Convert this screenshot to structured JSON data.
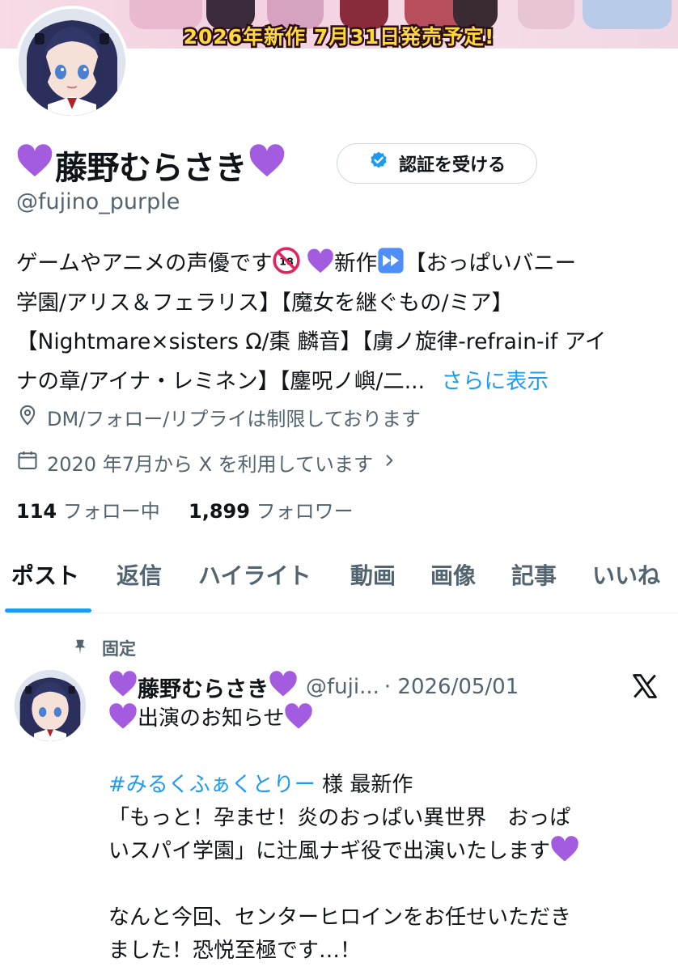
{
  "banner": {
    "text": "2026年新作 7月31日発売予定!"
  },
  "profile": {
    "display_name": "藤野むらさき",
    "handle": "@fujino_purple",
    "verify_button": "認証を受ける",
    "bio_lines": [
      "ゲームやアニメの声優です",
      "新作",
      "【おっぱいバニー",
      "学園/アリス＆フェラリス】【魔女を継ぐもの/ミア】",
      "【Nightmare×sisters Ω/棗 麟音】【虜ノ旋律-refrain-if アイ",
      "ナの章/アイナ・レミネン】【鏖呪ノ嶼/二...",
      "さらに表示"
    ],
    "location": "DM/フォロー/リプライは制限しております",
    "joined": "2020 年7月から X を利用しています",
    "following_count": "114",
    "following_label": "フォロー中",
    "followers_count": "1,899",
    "followers_label": "フォロワー"
  },
  "tabs": [
    "ポスト",
    "返信",
    "ハイライト",
    "動画",
    "画像",
    "記事",
    "いいね"
  ],
  "active_tab": "ポスト",
  "post": {
    "pinned_label": "固定",
    "author_name": "藤野むらさき",
    "author_handle": "@fuji...",
    "date": "· 2026/05/01",
    "lines": [
      "出演のお知らせ",
      "",
      "#みるくふぁくとりー",
      "様 最新作",
      "「もっと！孕ませ！炎のおっぱい異世界　おっぱ",
      "いスパイ学園」に辻風ナギ役で出演いたします",
      "",
      "なんと今回、センターヒロインをお任せいただき",
      "ました！恐悦至極です…！"
    ]
  },
  "colors": {
    "accent": "#1d9bf0",
    "heart": "#a35be0",
    "muted": "#536471",
    "text": "#0f1419"
  },
  "icons": [
    "verified-badge-icon",
    "purple-heart-icon",
    "no-under-18-icon",
    "fast-forward-icon",
    "location-pin-icon",
    "calendar-icon",
    "chevron-right-icon",
    "pin-icon",
    "x-logo-icon"
  ]
}
